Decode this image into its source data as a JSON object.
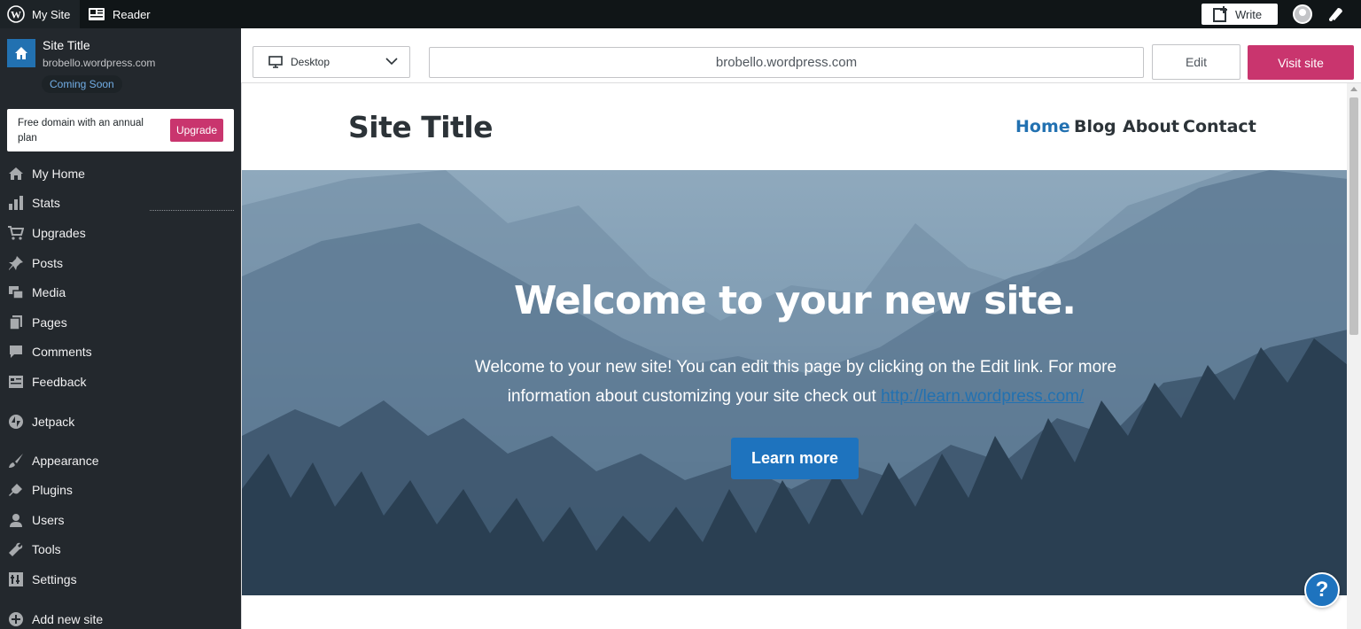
{
  "topbar": {
    "my_site": "My Site",
    "reader": "Reader",
    "write": "Write"
  },
  "sidebar": {
    "site_name": "Site Title",
    "site_url": "brobello.wordpress.com",
    "badge": "Coming Soon",
    "upgrade_text": "Free domain with an annual plan",
    "upgrade_button": "Upgrade",
    "items": [
      {
        "label": "My Home",
        "icon": "home-icon"
      },
      {
        "label": "Stats",
        "icon": "stats-icon"
      },
      {
        "label": "Upgrades",
        "icon": "cart-icon"
      },
      {
        "label": "Posts",
        "icon": "pin-icon"
      },
      {
        "label": "Media",
        "icon": "media-icon"
      },
      {
        "label": "Pages",
        "icon": "pages-icon"
      },
      {
        "label": "Comments",
        "icon": "comment-icon"
      },
      {
        "label": "Feedback",
        "icon": "feedback-icon"
      },
      {
        "label": "Jetpack",
        "icon": "jetpack-icon"
      },
      {
        "label": "Appearance",
        "icon": "brush-icon"
      },
      {
        "label": "Plugins",
        "icon": "plug-icon"
      },
      {
        "label": "Users",
        "icon": "user-icon"
      },
      {
        "label": "Tools",
        "icon": "wrench-icon"
      },
      {
        "label": "Settings",
        "icon": "settings-icon"
      },
      {
        "label": "Add new site",
        "icon": "plus-circle-icon"
      }
    ]
  },
  "preview_bar": {
    "device": "Desktop",
    "url": "brobello.wordpress.com",
    "edit": "Edit",
    "visit": "Visit site"
  },
  "site": {
    "title": "Site Title",
    "nav": [
      "Home",
      "Blog",
      "About",
      "Contact"
    ],
    "hero_title": "Welcome to your new site.",
    "hero_text": "Welcome to your new site! You can edit this page by clicking on the Edit link. For more information about customizing your site check out",
    "hero_link": "http://learn.wordpress.com/",
    "learn_more": "Learn more"
  },
  "help": "?",
  "colors": {
    "accent": "#c9356e",
    "link": "#2271b1",
    "sidebar_bg": "#23282d",
    "topbar_bg": "#101517"
  }
}
